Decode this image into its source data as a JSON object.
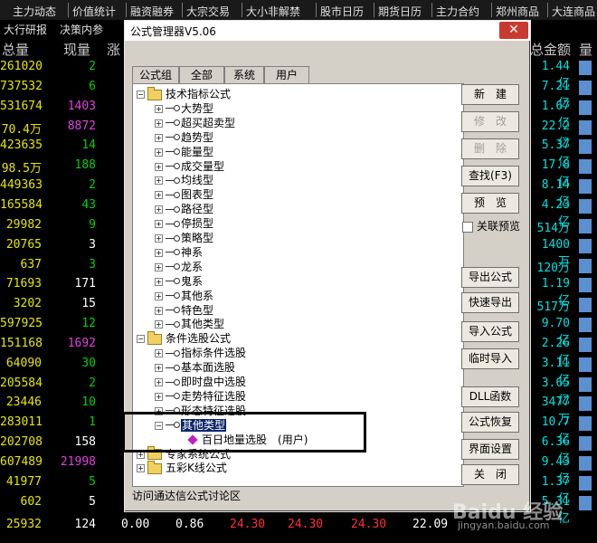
{
  "topnav": [
    "主力动态",
    "价值统计",
    "融资融券",
    "大宗交易",
    "大小非解禁",
    "股市日历",
    "期货日历",
    "主力合约",
    "郑州商品",
    "大连商品"
  ],
  "row2": [
    "大行研报",
    "决策内参"
  ],
  "headers": {
    "vol": "总量",
    "cur": "现量",
    "chg": "涨",
    "amt": "总金额",
    "right": "量"
  },
  "rows": [
    {
      "vol": "261020",
      "cur": "2",
      "cur_color": "#00d000",
      "amt": "1.44亿"
    },
    {
      "vol": "737532",
      "cur": "6",
      "cur_color": "#00d000",
      "amt": "7.21亿"
    },
    {
      "vol": "531674",
      "cur": "1403",
      "cur_color": "#e040e0",
      "amt": "1.67亿"
    },
    {
      "vol": "70.4万",
      "cur": "8872",
      "cur_color": "#e040e0",
      "amt": "22.2亿"
    },
    {
      "vol": "423635",
      "cur": "14",
      "cur_color": "#00d000",
      "amt": "5.37亿"
    },
    {
      "vol": "98.5万",
      "cur": "188",
      "cur_color": "#00d000",
      "amt": "17.8亿"
    },
    {
      "vol": "449363",
      "cur": "2",
      "cur_color": "#00d000",
      "amt": "8.14亿"
    },
    {
      "vol": "165584",
      "cur": "43",
      "cur_color": "#00d000",
      "amt": "4.23亿"
    },
    {
      "vol": "29982",
      "cur": "9",
      "cur_color": "#00d000",
      "amt": "514万"
    },
    {
      "vol": "20765",
      "cur": "3",
      "cur_color": "#ffffff",
      "amt": "1400万"
    },
    {
      "vol": "637",
      "cur": "3",
      "cur_color": "#00d000",
      "amt": "120万"
    },
    {
      "vol": "71693",
      "cur": "171",
      "cur_color": "#ffffff",
      "amt": "1.19亿"
    },
    {
      "vol": "3202",
      "cur": "15",
      "cur_color": "#ffffff",
      "amt": "517万"
    },
    {
      "vol": "597925",
      "cur": "12",
      "cur_color": "#00d000",
      "amt": "9.70亿"
    },
    {
      "vol": "151168",
      "cur": "1692",
      "cur_color": "#e040e0",
      "amt": "2.26亿"
    },
    {
      "vol": "64090",
      "cur": "30",
      "cur_color": "#00d000",
      "amt": "3.11亿"
    },
    {
      "vol": "205584",
      "cur": "2",
      "cur_color": "#00d000",
      "amt": "3.65亿"
    },
    {
      "vol": "23446",
      "cur": "10",
      "cur_color": "#00d000",
      "amt": "3477万"
    },
    {
      "vol": "283011",
      "cur": "1",
      "cur_color": "#00d000",
      "amt": "10.7亿"
    },
    {
      "vol": "202708",
      "cur": "158",
      "cur_color": "#ffffff",
      "amt": "6.36亿"
    },
    {
      "vol": "607489",
      "cur": "21998",
      "cur_color": "#e040e0",
      "amt": "9.43亿"
    },
    {
      "vol": "41977",
      "cur": "5",
      "cur_color": "#00d000",
      "amt": "1.37亿"
    },
    {
      "vol": "602",
      "cur": "5",
      "cur_color": "#ffffff",
      "amt": "5.31亿"
    }
  ],
  "bottom_row": {
    "vol": "25932",
    "cur": "124",
    "c1": "0.00",
    "c2": "0.86",
    "c3": "24.30",
    "c4": "24.30",
    "c5": "24.30",
    "c6": "22.09"
  },
  "dialog": {
    "title": "公式管理器V5.06",
    "close": "✕",
    "tabs": [
      "公式组",
      "全部",
      "系统",
      "用户"
    ],
    "buttons": [
      {
        "label": "新　建",
        "disabled": false
      },
      {
        "label": "修　改",
        "disabled": true
      },
      {
        "label": "删　除",
        "disabled": true
      },
      {
        "label": "查找(F3)",
        "disabled": false
      },
      {
        "label": "预　览",
        "disabled": false
      },
      {
        "label": "导出公式",
        "disabled": false
      },
      {
        "label": "快速导出",
        "disabled": false
      },
      {
        "label": "导入公式",
        "disabled": false
      },
      {
        "label": "临时导入",
        "disabled": false
      },
      {
        "label": "DLL函数",
        "disabled": false
      },
      {
        "label": "公式恢复",
        "disabled": false
      },
      {
        "label": "界面设置",
        "disabled": false
      },
      {
        "label": "关　闭",
        "disabled": false
      }
    ],
    "checkbox_label": "关联预览",
    "status": "访问通达信公式讨论区",
    "tree": {
      "group1": "技术指标公式",
      "group1_items": [
        "大势型",
        "超买超卖型",
        "趋势型",
        "能量型",
        "成交量型",
        "均线型",
        "图表型",
        "路径型",
        "停损型",
        "策略型",
        "神系",
        "龙系",
        "鬼系",
        "其他系",
        "特色型",
        "其他类型"
      ],
      "group2": "条件选股公式",
      "group2_items": [
        "指标条件选股",
        "基本面选股",
        "即时盘中选股",
        "走势特征选股",
        "形态特征选股"
      ],
      "selected": "其他类型",
      "child": "百日地量选股",
      "child_tag": "(用户)",
      "group3": "专家系统公式",
      "group4": "五彩K线公式"
    }
  },
  "watermark": "Baidu 经验",
  "watermark_url": "jingyan.baidu.com"
}
